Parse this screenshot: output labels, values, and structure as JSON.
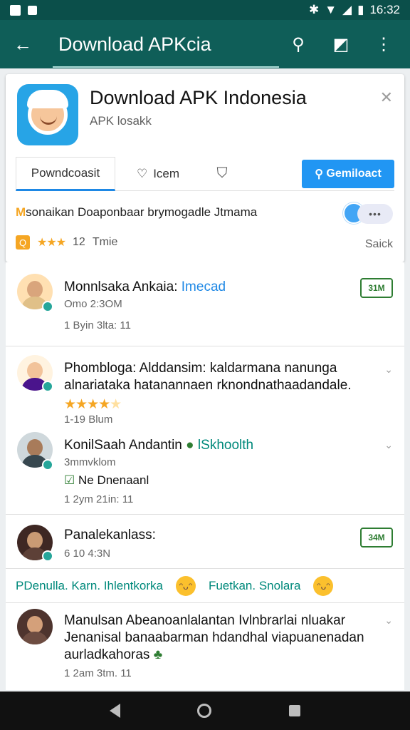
{
  "statusbar": {
    "time": "16:32",
    "icons": [
      "bluetooth-icon",
      "wifi-icon",
      "signal-icon",
      "battery-icon"
    ]
  },
  "appbar": {
    "title": "Download APKcia",
    "icons": [
      "back-arrow-icon",
      "search-icon",
      "edit-icon",
      "more-vertical-icon"
    ]
  },
  "app": {
    "title": "Download APK Indonesia",
    "subtitle": "APK losakk",
    "icon": "app-face-icon"
  },
  "tabs": {
    "active": "Powndcoasit",
    "like": "Icem",
    "download_button": "Gemiloact",
    "download_icon": "location-pin-icon"
  },
  "promo": {
    "text": "sonaikan Doaponbaar brymogadle Jtmama",
    "prefix": "M"
  },
  "meta": {
    "badge": "Q",
    "stars": "★★★",
    "count": "12",
    "label": "Tmie",
    "right": "Saick"
  },
  "colors": {
    "primary": "#0f5e58",
    "accent": "#2196f3",
    "star": "#f5a623",
    "badge_green": "#2e7d32"
  },
  "items": [
    {
      "name": "Monnlsaka Ankaia:",
      "accent": "Imecad",
      "line1": "Omo 2:3OM",
      "line2": "1 Byin 3lta: 11",
      "badge": "31M"
    },
    {
      "name": "Phombloga: Alddansim: kaldarmana nanunga",
      "name2": "alnariataka hatanannaen rknondnathaadandale.",
      "stars": "★★★★",
      "star_empty": "★",
      "line1": "1-19 Blum"
    },
    {
      "name": "KonilSaah Andantin",
      "accent": "lSkhoolth",
      "line1": "3mmvklom",
      "check": "☑",
      "line2": "Ne Dnenaanl",
      "line3": "1 2ym 21in: 11"
    },
    {
      "name": "Panalekanlass:",
      "line1": "6 10 4:3N",
      "badge": "34M"
    }
  ],
  "tag_row": {
    "left": "PDenulla. Karn. Ihlentkorka",
    "middle": "Fuetkan. Snolara"
  },
  "last_item": {
    "name": "Manulsan Abeanoanlalantan Ivlnbrarlai nluakar",
    "name2": "Jenanisal banaabarman hdandhal viapuanenadan",
    "name3": "aurladkahoras",
    "line": "1 2am 3tm. 11"
  }
}
